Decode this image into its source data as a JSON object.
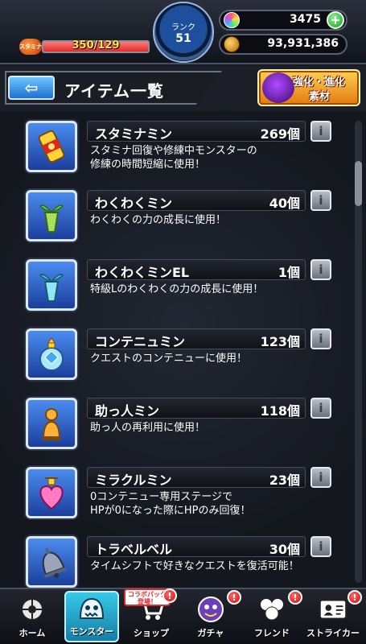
{
  "status": {
    "stamina_label": "スタミナ",
    "stamina_text": "350/129",
    "rank_label": "ランク",
    "rank_value": "51",
    "orb_count": "3475",
    "gold_count": "93,931,386",
    "plus_label": "+"
  },
  "header": {
    "back_arrow": "⇦",
    "title": "アイテム一覧",
    "evolve_line1": "強化・進化",
    "evolve_line2": "素材"
  },
  "items": [
    {
      "name": "スタミナミン",
      "count": "269個",
      "desc": "スタミナ回復や修練中モンスターの\n修練の時間短縮に使用！",
      "icon": "stamina-can-icon"
    },
    {
      "name": "わくわくミン",
      "count": "40個",
      "desc": "わくわくの力の成長に使用！",
      "icon": "sprout-bottle-icon"
    },
    {
      "name": "わくわくミンEL",
      "count": "1個",
      "desc": "特級Lのわくわくの力の成長に使用！",
      "icon": "sprout-bottle-el-icon"
    },
    {
      "name": "コンテニュミン",
      "count": "123個",
      "desc": "クエストのコンテニューに使用！",
      "icon": "crystal-flask-icon"
    },
    {
      "name": "助っ人ミン",
      "count": "118個",
      "desc": "助っ人の再利用に使用！",
      "icon": "helper-figure-icon"
    },
    {
      "name": "ミラクルミン",
      "count": "23個",
      "desc": "0コンテニュー専用ステージで\nHPが0になった際にHPのみ回復！",
      "icon": "heart-flask-icon"
    },
    {
      "name": "トラベルベル",
      "count": "30個",
      "desc": "タイムシフトで好きなクエストを復活可能！",
      "icon": "bell-icon"
    }
  ],
  "info_label": "i",
  "nav": {
    "home": "ホーム",
    "monster": "モンスター",
    "shop": "ショップ",
    "gacha": "ガチャ",
    "friend": "フレンド",
    "striker": "ストライカー",
    "collab_tag": "コラボパック\n登場！",
    "badge": "!"
  },
  "colors": {
    "accent_blue": "#1f6fd0",
    "active_tab": "#37c9e8",
    "badge_red": "#c8100e",
    "gold": "#e27a10"
  }
}
